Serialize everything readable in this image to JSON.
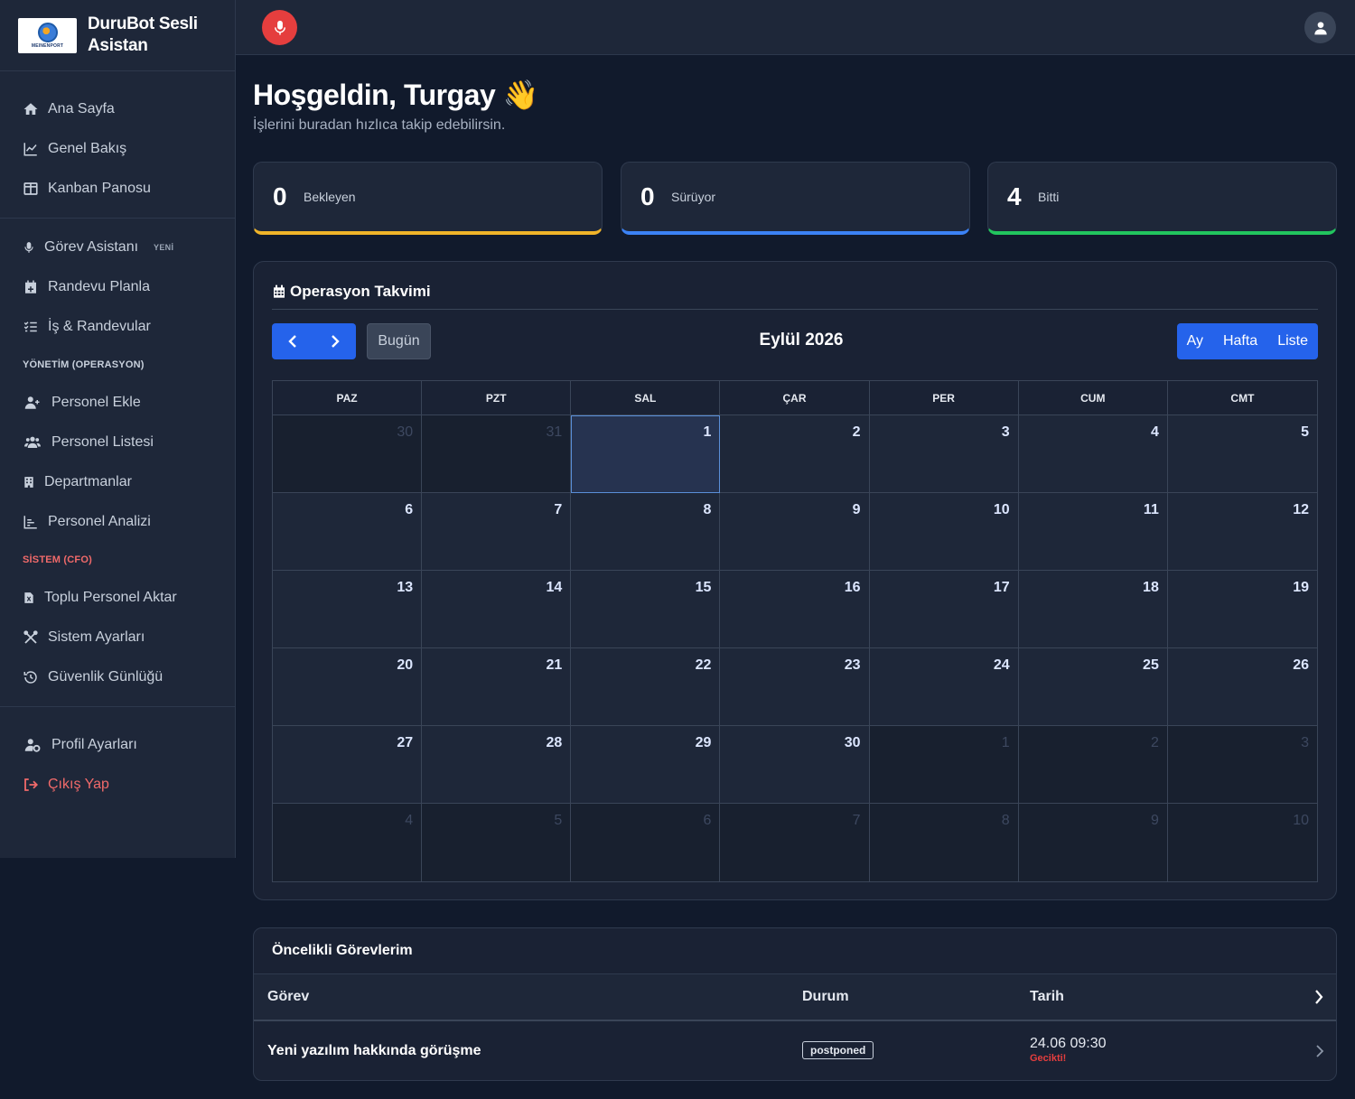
{
  "brand": {
    "name": "DuruBot Sesli Asistan",
    "logo_text": "MEINENPORT"
  },
  "sidebar": {
    "group1": [
      {
        "label": "Ana Sayfa",
        "icon": "home-icon"
      },
      {
        "label": "Genel Bakış",
        "icon": "chart-line-icon"
      },
      {
        "label": "Kanban Panosu",
        "icon": "columns-icon"
      }
    ],
    "group2": [
      {
        "label": "Görev Asistanı",
        "icon": "microphone-icon",
        "badge": "YENİ"
      },
      {
        "label": "Randevu Planla",
        "icon": "calendar-plus-icon"
      },
      {
        "label": "İş & Randevular",
        "icon": "list-check-icon"
      }
    ],
    "section_management": "YÖNETİM (OPERASYON)",
    "management": [
      {
        "label": "Personel Ekle",
        "icon": "user-plus-icon"
      },
      {
        "label": "Personel Listesi",
        "icon": "users-icon"
      },
      {
        "label": "Departmanlar",
        "icon": "building-icon"
      },
      {
        "label": "Personel Analizi",
        "icon": "chart-bar-icon"
      }
    ],
    "section_system": "SİSTEM (CFO)",
    "system": [
      {
        "label": "Toplu Personel Aktar",
        "icon": "file-excel-icon"
      },
      {
        "label": "Sistem Ayarları",
        "icon": "tools-icon"
      },
      {
        "label": "Güvenlik Günlüğü",
        "icon": "history-icon"
      }
    ],
    "bottom": [
      {
        "label": "Profil Ayarları",
        "icon": "user-gear-icon"
      },
      {
        "label": "Çıkış Yap",
        "icon": "sign-out-icon"
      }
    ]
  },
  "header": {
    "welcome": "Hoşgeldin, Turgay 👋",
    "subtitle": "İşlerini buradan hızlıca takip edebilirsin."
  },
  "stats": [
    {
      "value": "0",
      "label": "Bekleyen",
      "color": "#f0b429"
    },
    {
      "value": "0",
      "label": "Sürüyor",
      "color": "#3b82f6"
    },
    {
      "value": "4",
      "label": "Bitti",
      "color": "#22c55e"
    }
  ],
  "calendar": {
    "title": "Operasyon Takvimi",
    "today_label": "Bugün",
    "month": "Eylül 2026",
    "views": [
      "Ay",
      "Hafta",
      "Liste"
    ],
    "weekdays": [
      "PAZ",
      "PZT",
      "SAL",
      "ÇAR",
      "PER",
      "CUM",
      "CMT"
    ],
    "weeks": [
      [
        "30",
        "31",
        "1",
        "2",
        "3",
        "4",
        "5"
      ],
      [
        "6",
        "7",
        "8",
        "9",
        "10",
        "11",
        "12"
      ],
      [
        "13",
        "14",
        "15",
        "16",
        "17",
        "18",
        "19"
      ],
      [
        "20",
        "21",
        "22",
        "23",
        "24",
        "25",
        "26"
      ],
      [
        "27",
        "28",
        "29",
        "30",
        "1",
        "2",
        "3"
      ],
      [
        "4",
        "5",
        "6",
        "7",
        "8",
        "9",
        "10"
      ]
    ]
  },
  "tasks": {
    "title": "Öncelikli Görevlerim",
    "columns": [
      "Görev",
      "Durum",
      "Tarih"
    ],
    "rows": [
      {
        "name": "Yeni yazılım hakkında görüşme",
        "status": "postponed",
        "date": "24.06 09:30",
        "late": "Gecikti!"
      }
    ]
  }
}
